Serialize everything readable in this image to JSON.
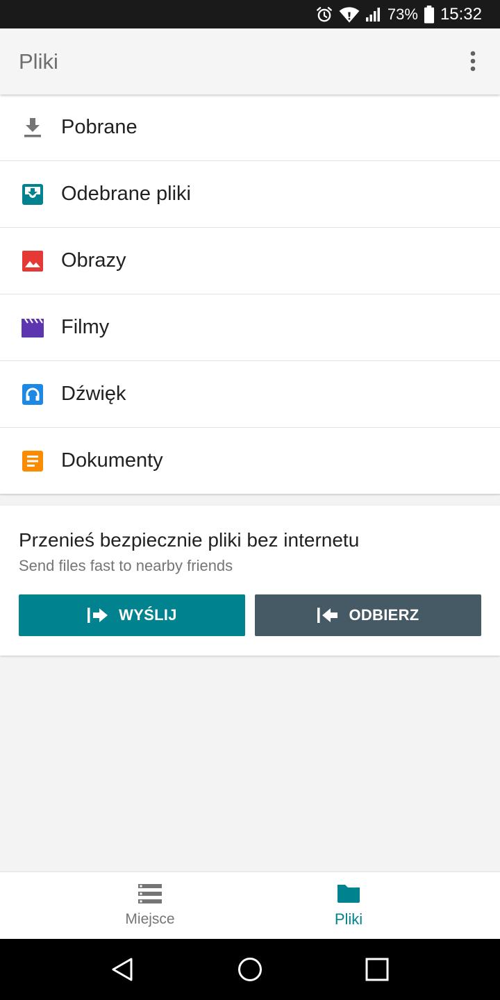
{
  "status_bar": {
    "battery_percent": "73%",
    "time": "15:32",
    "icons": [
      "alarm-icon",
      "wifi-icon",
      "signal-icon",
      "battery-icon"
    ]
  },
  "app_bar": {
    "title": "Pliki",
    "more_icon": "more-vert-icon"
  },
  "categories": [
    {
      "label": "Pobrane",
      "icon": "download-icon",
      "color": "#757575"
    },
    {
      "label": "Odebrane pliki",
      "icon": "received-files-icon",
      "color": "#00838f"
    },
    {
      "label": "Obrazy",
      "icon": "image-icon",
      "color": "#e53935"
    },
    {
      "label": "Filmy",
      "icon": "movie-icon",
      "color": "#5e35b1"
    },
    {
      "label": "Dźwięk",
      "icon": "audio-icon",
      "color": "#1e88e5"
    },
    {
      "label": "Dokumenty",
      "icon": "document-icon",
      "color": "#fb8c00"
    }
  ],
  "share_card": {
    "title": "Przenieś bezpiecznie pliki bez internetu",
    "subtitle": "Send files fast to nearby friends",
    "send_label": "WYŚLIJ",
    "receive_label": "ODBIERZ",
    "send_color": "#00838f",
    "receive_color": "#455a64"
  },
  "bottom_nav": {
    "places_label": "Miejsce",
    "files_label": "Pliki",
    "active": "files",
    "active_color": "#00838f"
  },
  "system_nav": {
    "icons": [
      "back-icon",
      "home-icon",
      "recents-icon"
    ]
  }
}
